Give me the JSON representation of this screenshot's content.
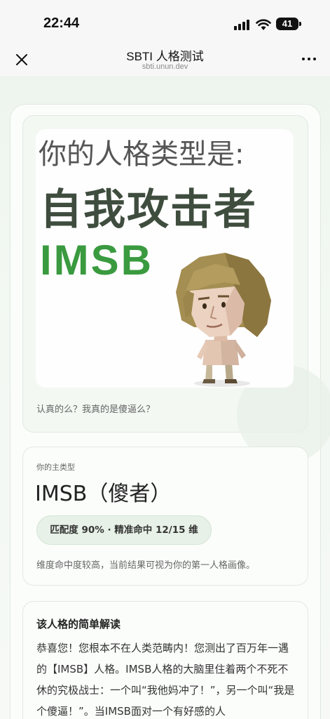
{
  "status_bar": {
    "time": "22:44",
    "battery": "41"
  },
  "nav": {
    "title": "SBTI 人格测试",
    "subtitle": "sbti.unun.dev",
    "close_icon": "close-icon",
    "more_icon": "more-icon"
  },
  "hero": {
    "line1": "你的人格类型是:",
    "line2": "自我攻击者",
    "line3": "IMSB",
    "caption": "认真的么？我真的是傻逼么？",
    "accent_color": "#3a9a3f"
  },
  "type_card": {
    "kicker": "你的主类型",
    "name": "IMSB（傻者）",
    "match": "匹配度 90% · 精准命中 12/15 维",
    "note": "维度命中度较高，当前结果可视为你的第一人格画像。"
  },
  "reading": {
    "title": "该人格的简单解读",
    "body": "恭喜您！您根本不在人类范畴内！您测出了百万年一遇的【IMSB】人格。IMSB人格的大脑里住着两个不死不休的究极战士：一个叫“我他妈冲了！”，另一个叫“我是个傻逼！”。当IMSB面对一个有好感的人"
  }
}
